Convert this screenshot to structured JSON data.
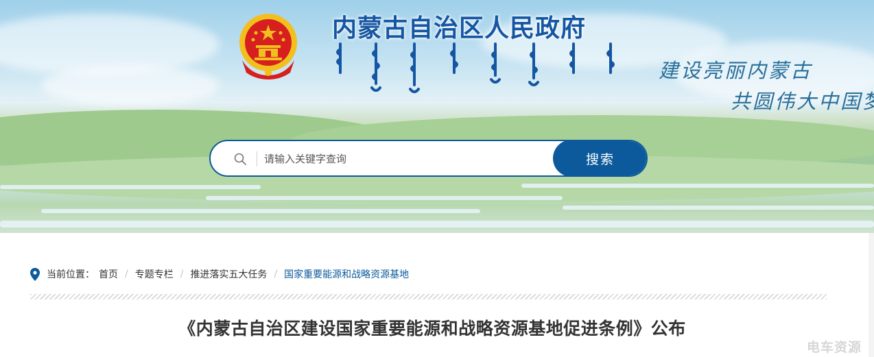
{
  "header": {
    "site_title": "内蒙古自治区人民政府",
    "slogan_line1": "建设亮丽内蒙古",
    "slogan_line2": "共圆伟大中国梦"
  },
  "search": {
    "placeholder": "请输入关键字查询",
    "button_label": "搜索"
  },
  "breadcrumb": {
    "label": "当前位置：",
    "items": [
      "首页",
      "专题专栏",
      "推进落实五大任务",
      "国家重要能源和战略资源基地"
    ],
    "separator": "/"
  },
  "article": {
    "title": "《内蒙古自治区建设国家重要能源和战略资源基地促进条例》公布"
  },
  "watermark": "电车资源",
  "colors": {
    "brand_blue": "#1556a3",
    "button_blue": "#0c5a9b",
    "emblem_red": "#d71f1f",
    "emblem_gold": "#f2c01e"
  },
  "icons": {
    "search": "search-icon",
    "location": "location-pin-icon",
    "emblem": "national-emblem-icon"
  }
}
